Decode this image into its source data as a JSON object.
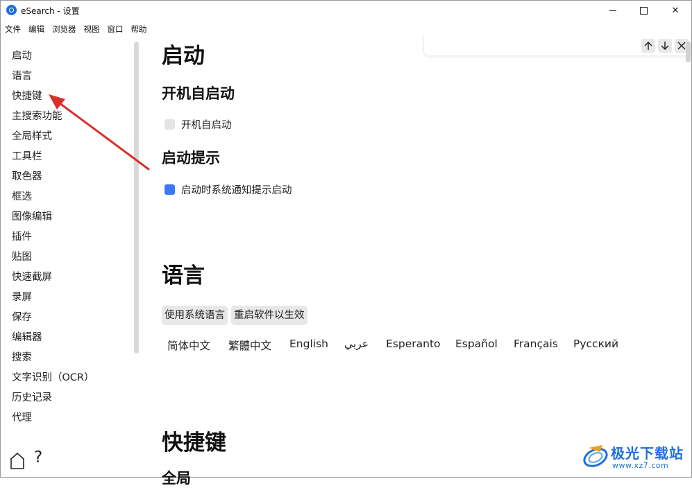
{
  "window": {
    "title": "eSearch - 设置",
    "minimize_glyph": "",
    "close_glyph": "✕"
  },
  "menubar": [
    "文件",
    "编辑",
    "浏览器",
    "视图",
    "窗口",
    "帮助"
  ],
  "sidebar": {
    "items": [
      "启动",
      "语言",
      "快捷键",
      "主搜索功能",
      "全局样式",
      "工具栏",
      "取色器",
      "框选",
      "图像编辑",
      "插件",
      "贴图",
      "快速截屏",
      "录屏",
      "保存",
      "编辑器",
      "搜索",
      "文字识别（OCR）",
      "历史记录",
      "代理"
    ],
    "help_label": "?"
  },
  "main": {
    "startup": {
      "title": "启动",
      "autostart_heading": "开机自启动",
      "autostart_label": "开机自启动",
      "autostart_checked": false,
      "notify_heading": "启动提示",
      "notify_label": "启动时系统通知提示启动",
      "notify_checked": true
    },
    "language": {
      "title": "语言",
      "use_system_button": "使用系统语言",
      "restart_button": "重启软件以生效",
      "options": [
        "简体中文",
        "繁體中文",
        "English",
        "عربي",
        "Esperanto",
        "Español",
        "Français",
        "Русский"
      ]
    },
    "shortcuts": {
      "title": "快捷键",
      "partial_heading": "全局"
    }
  },
  "colors": {
    "accent": "#3b78f2",
    "arrow": "#d9302c",
    "watermark": "#1e6fd9"
  },
  "watermark": {
    "brand": "极光下载站",
    "url": "www.xz7.com"
  }
}
